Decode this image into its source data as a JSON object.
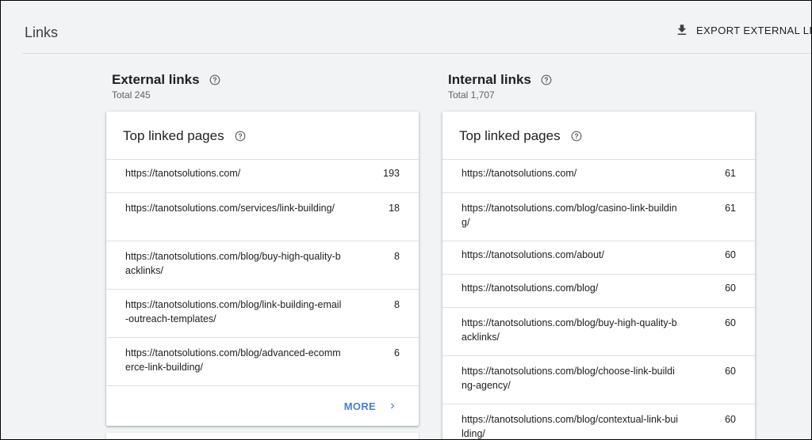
{
  "header": {
    "title": "Links",
    "export_label": "EXPORT EXTERNAL LINKS"
  },
  "external": {
    "title": "External links",
    "total": "Total 245",
    "card_title": "Top linked pages",
    "rows": [
      {
        "url": "https://tanotsolutions.com/",
        "count": "193"
      },
      {
        "url": "https://tanotsolutions.com/services/link-building/",
        "count": "18"
      },
      {
        "url": "https://tanotsolutions.com/blog/buy-high-quality-backlinks/",
        "count": "8"
      },
      {
        "url": "https://tanotsolutions.com/blog/link-building-email-outreach-templates/",
        "count": "8"
      },
      {
        "url": "https://tanotsolutions.com/blog/advanced-ecommerce-link-building/",
        "count": "6"
      }
    ],
    "more_label": "MORE"
  },
  "internal": {
    "title": "Internal links",
    "total": "Total 1,707",
    "card_title": "Top linked pages",
    "rows": [
      {
        "url": "https://tanotsolutions.com/",
        "count": "61"
      },
      {
        "url": "https://tanotsolutions.com/blog/casino-link-building/",
        "count": "61"
      },
      {
        "url": "https://tanotsolutions.com/about/",
        "count": "60"
      },
      {
        "url": "https://tanotsolutions.com/blog/",
        "count": "60"
      },
      {
        "url": "https://tanotsolutions.com/blog/buy-high-quality-backlinks/",
        "count": "60"
      },
      {
        "url": "https://tanotsolutions.com/blog/choose-link-building-agency/",
        "count": "60"
      },
      {
        "url": "https://tanotsolutions.com/blog/contextual-link-building/",
        "count": "60"
      }
    ]
  },
  "colors": {
    "background": "#f1f3f4",
    "card": "#ffffff",
    "accent": "#4a7fd6",
    "text": "#202124",
    "muted": "#5f6368"
  },
  "icons": {
    "help": "help-circle-icon",
    "download": "download-icon",
    "chevron": "chevron-right-icon"
  }
}
